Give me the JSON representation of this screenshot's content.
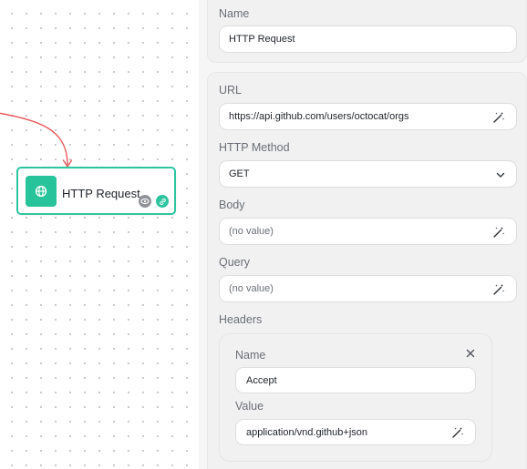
{
  "node": {
    "title": "HTTP Request",
    "icon": "globe-icon",
    "accent": "#27c39a"
  },
  "panel": {
    "name_label": "Name",
    "name_value": "HTTP Request",
    "url_label": "URL",
    "url_value": "https://api.github.com/users/octocat/orgs",
    "method_label": "HTTP Method",
    "method_value": "GET",
    "body_label": "Body",
    "body_value": "(no value)",
    "query_label": "Query",
    "query_value": "(no value)",
    "headers_label": "Headers",
    "headers": [
      {
        "name_label": "Name",
        "name_value": "Accept",
        "value_label": "Value",
        "value_value": "application/vnd.github+json"
      }
    ]
  }
}
